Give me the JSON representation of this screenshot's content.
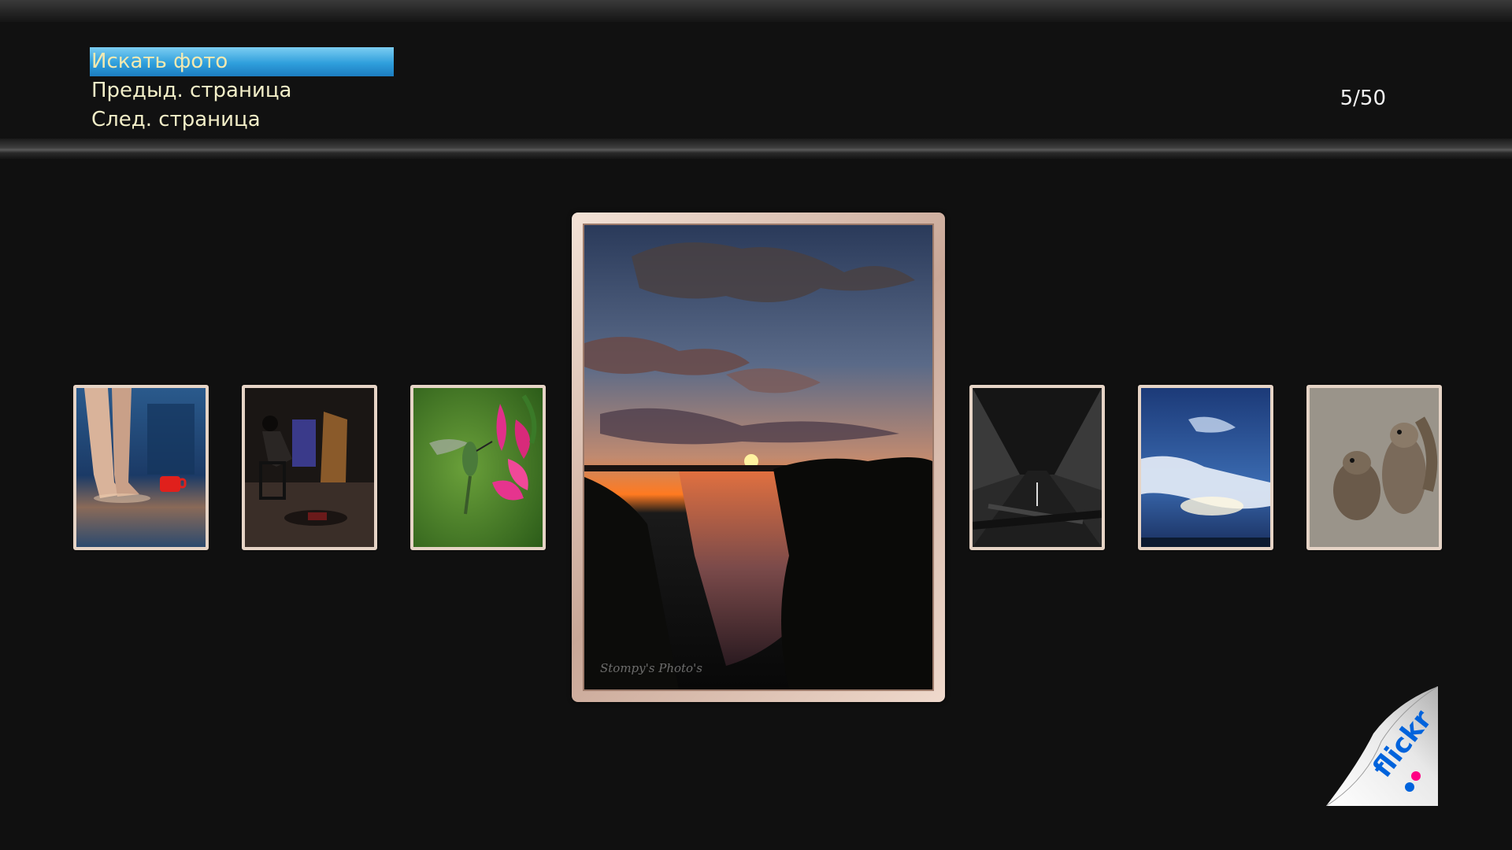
{
  "menu": {
    "items": [
      {
        "label": "Искать фото"
      },
      {
        "label": "Предыд. страница"
      },
      {
        "label": "След. страница"
      }
    ],
    "selected_index": 0
  },
  "page_counter": "5/50",
  "photos": {
    "left": [
      {
        "subject": "bare feet with red cup"
      },
      {
        "subject": "person sitting on stool"
      },
      {
        "subject": "hummingbird and pink flowers"
      }
    ],
    "focused": {
      "subject": "sunset over lake with reeds",
      "watermark": "Stompy's Photo's"
    },
    "right": [
      {
        "subject": "black and white tree-lined road"
      },
      {
        "subject": "blue sky with clouds"
      },
      {
        "subject": "two squirrels"
      }
    ]
  },
  "logo": {
    "name": "flickr-logo",
    "text": "flickr"
  },
  "colors": {
    "highlight": "#2f9fdc",
    "menu_text": "#f2eec8",
    "frame": "#e6d4c6",
    "flickr_blue": "#0063dc",
    "flickr_pink": "#ff0084"
  }
}
